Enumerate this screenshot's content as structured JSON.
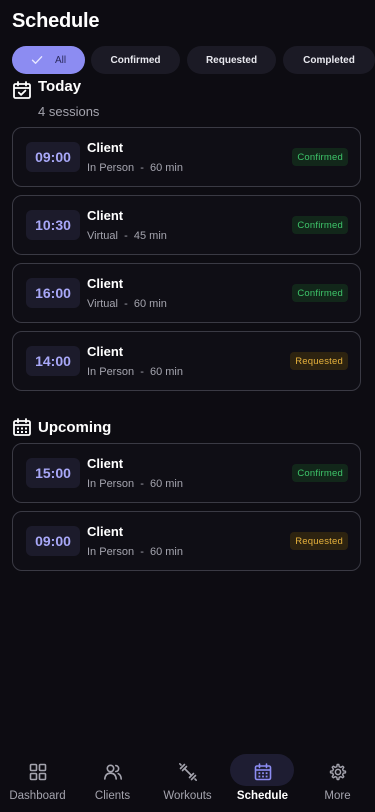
{
  "header": {
    "title": "Schedule"
  },
  "filters": [
    {
      "label": "All",
      "active": true
    },
    {
      "label": "Confirmed",
      "active": false
    },
    {
      "label": "Requested",
      "active": false
    },
    {
      "label": "Completed",
      "active": false
    }
  ],
  "today": {
    "title": "Today",
    "subtitle": "4 sessions",
    "icon": "calendar-check-icon",
    "sessions": [
      {
        "time": "09:00",
        "client": "Client",
        "meta": "In Person  -  60 min",
        "status": "Confirmed"
      },
      {
        "time": "10:30",
        "client": "Client",
        "meta": "Virtual  -  45 min",
        "status": "Confirmed"
      },
      {
        "time": "16:00",
        "client": "Client",
        "meta": "Virtual  -  60 min",
        "status": "Confirmed"
      },
      {
        "time": "14:00",
        "client": "Client",
        "meta": "In Person  -  60 min",
        "status": "Requested"
      }
    ]
  },
  "upcoming": {
    "title": "Upcoming",
    "icon": "calendar-grid-icon",
    "sessions": [
      {
        "time": "15:00",
        "client": "Client",
        "meta": "In Person  -  60 min",
        "status": "Confirmed"
      },
      {
        "time": "09:00",
        "client": "Client",
        "meta": "In Person  -  60 min",
        "status": "Requested"
      }
    ]
  },
  "nav": [
    {
      "label": "Dashboard",
      "icon": "dashboard-icon",
      "active": false
    },
    {
      "label": "Clients",
      "icon": "users-icon",
      "active": false
    },
    {
      "label": "Workouts",
      "icon": "dumbbell-icon",
      "active": false
    },
    {
      "label": "Schedule",
      "icon": "calendar-icon",
      "active": true
    },
    {
      "label": "More",
      "icon": "gear-icon",
      "active": false
    }
  ],
  "colors": {
    "background": "#0d0c12",
    "accent": "#8c8cf2",
    "confirmed": "#3ec46a",
    "requested": "#e7b23c"
  }
}
